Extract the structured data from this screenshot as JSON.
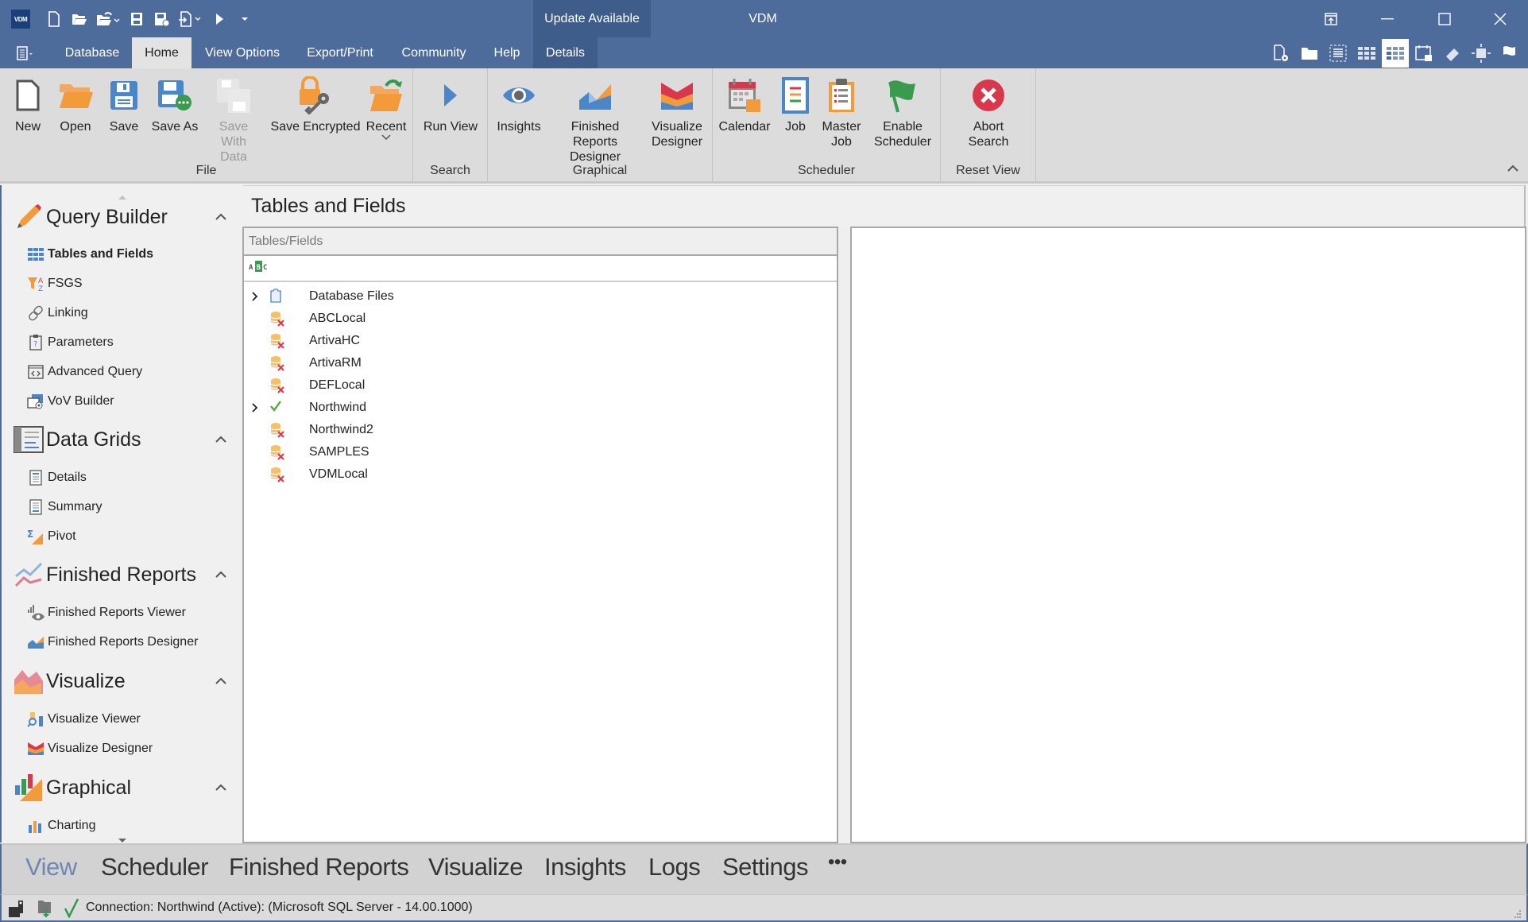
{
  "window": {
    "title": "VDM",
    "logo_text": "VDM",
    "update_label": "Update Available",
    "colors": {
      "titlebar": "#4e6c9b",
      "accent_dark": "#3f5d8b",
      "ribbon": "#dcdcdc"
    }
  },
  "quick_access": [
    "new-file-icon",
    "open-folder-icon",
    "open-recent-icon",
    "save-icon",
    "save-as-icon",
    "import-icon",
    "run-icon",
    "customize-dropdown-icon"
  ],
  "menu_tabs": [
    {
      "label": "Database"
    },
    {
      "label": "Home",
      "active": true
    },
    {
      "label": "View Options"
    },
    {
      "label": "Export/Print"
    },
    {
      "label": "Community"
    },
    {
      "label": "Help"
    },
    {
      "label": "Details"
    }
  ],
  "right_toolbar": [
    "page-settings-icon",
    "folder-icon",
    "select-all-icon",
    "grid-icon",
    "grid-active-icon",
    "calendar-grid-icon",
    "eraser-icon",
    "fit-icon",
    "flag-icon"
  ],
  "ribbon": {
    "groups": [
      {
        "label": "File",
        "buttons": [
          {
            "label": "New"
          },
          {
            "label": "Open"
          },
          {
            "label": "Save"
          },
          {
            "label": "Save As"
          },
          {
            "label": "Save With\nData",
            "disabled": true
          },
          {
            "label": "Save Encrypted"
          },
          {
            "label": "Recent"
          }
        ]
      },
      {
        "label": "Search",
        "buttons": [
          {
            "label": "Run View"
          }
        ]
      },
      {
        "label": "Graphical",
        "buttons": [
          {
            "label": "Insights"
          },
          {
            "label": "Finished Reports\nDesigner"
          },
          {
            "label": "Visualize\nDesigner"
          }
        ]
      },
      {
        "label": "Scheduler",
        "buttons": [
          {
            "label": "Calendar"
          },
          {
            "label": "Job"
          },
          {
            "label": "Master\nJob"
          },
          {
            "label": "Enable\nScheduler"
          }
        ]
      },
      {
        "label": "Reset View",
        "buttons": [
          {
            "label": "Abort\nSearch"
          }
        ]
      }
    ]
  },
  "sidebar": {
    "sections": [
      {
        "title": "Query Builder",
        "items": [
          {
            "label": "Tables and Fields",
            "active": true
          },
          {
            "label": "FSGS"
          },
          {
            "label": "Linking"
          },
          {
            "label": "Parameters"
          },
          {
            "label": "Advanced Query"
          },
          {
            "label": "VoV Builder"
          }
        ]
      },
      {
        "title": "Data Grids",
        "items": [
          {
            "label": "Details"
          },
          {
            "label": "Summary"
          },
          {
            "label": "Pivot"
          }
        ]
      },
      {
        "title": "Finished Reports",
        "items": [
          {
            "label": "Finished Reports Viewer"
          },
          {
            "label": "Finished Reports Designer"
          }
        ]
      },
      {
        "title": "Visualize",
        "items": [
          {
            "label": "Visualize Viewer"
          },
          {
            "label": "Visualize Designer"
          }
        ]
      },
      {
        "title": "Graphical",
        "items": [
          {
            "label": "Charting"
          }
        ]
      }
    ]
  },
  "main": {
    "title": "Tables and Fields",
    "panel_header": "Tables/Fields",
    "tree": [
      {
        "label": "Database Files",
        "expandable": true,
        "icon": "database-files-icon"
      },
      {
        "label": "ABCLocal",
        "icon": "db-disconnected-icon"
      },
      {
        "label": "ArtivaHC",
        "icon": "db-disconnected-icon"
      },
      {
        "label": "ArtivaRM",
        "icon": "db-disconnected-icon"
      },
      {
        "label": "DEFLocal",
        "icon": "db-disconnected-icon"
      },
      {
        "label": "Northwind",
        "expandable": true,
        "icon": "connected-check-icon"
      },
      {
        "label": "Northwind2",
        "icon": "db-disconnected-icon"
      },
      {
        "label": "SAMPLES",
        "icon": "db-disconnected-icon"
      },
      {
        "label": "VDMLocal",
        "icon": "db-disconnected-icon"
      }
    ]
  },
  "bottom_nav": {
    "items": [
      {
        "label": "View",
        "active": true
      },
      {
        "label": "Scheduler"
      },
      {
        "label": "Finished Reports"
      },
      {
        "label": "Visualize"
      },
      {
        "label": "Insights"
      },
      {
        "label": "Logs"
      },
      {
        "label": "Settings"
      },
      {
        "label": "•••"
      }
    ]
  },
  "status": {
    "connection_text": "Connection: Northwind (Active): (Microsoft SQL Server - 14.00.1000)"
  }
}
